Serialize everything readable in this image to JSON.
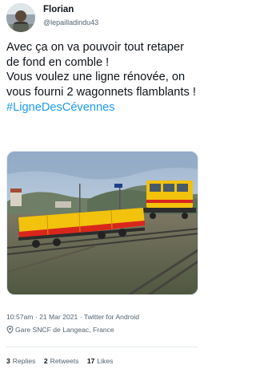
{
  "author": {
    "name": "Florian",
    "handle": "@lepailladindu43"
  },
  "tweet": {
    "lines": [
      "Avec ça on va pouvoir tout retaper de fond en comble !",
      "Vous voulez une ligne rénovée, on vous fourni 2 wagonnets flamblants !"
    ],
    "hashtag": "#LigneDesCévennes"
  },
  "meta": {
    "timestamp": "10:57am · 21 Mar 2021 · Twitter for Android",
    "location": "Gare SNCF de Langeac, France"
  },
  "stats": {
    "replies_count": "3",
    "replies_label": "Replies",
    "retweets_count": "2",
    "retweets_label": "Retweets",
    "likes_count": "17",
    "likes_label": "Likes"
  },
  "colors": {
    "link": "#1d9bf0",
    "secondary_text": "#536471",
    "wagon_yellow": "#f2c20c",
    "wagon_red": "#d8261d"
  }
}
